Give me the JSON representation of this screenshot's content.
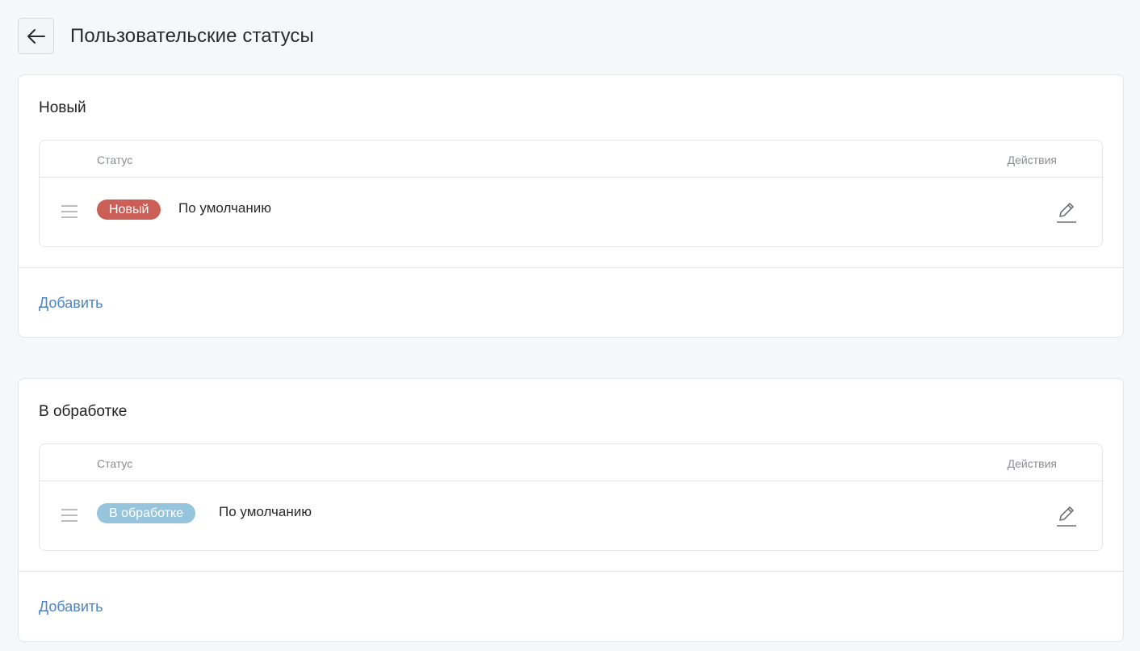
{
  "page": {
    "title": "Пользовательские статусы",
    "back_icon": "arrow-left-icon"
  },
  "table_headers": {
    "status": "Статус",
    "actions": "Действия"
  },
  "groups": [
    {
      "title": "Новый",
      "rows": [
        {
          "badge": "Новый",
          "badge_color": "#cb5f57",
          "default_label": "По умолчанию",
          "drag_icon": "drag-handle-icon",
          "edit_icon": "pencil-edit-icon"
        }
      ],
      "add_label": "Добавить"
    },
    {
      "title": "В обработке",
      "rows": [
        {
          "badge": "В обработке",
          "badge_color": "#96c4dc",
          "default_label": "По умолчанию",
          "drag_icon": "drag-handle-icon",
          "edit_icon": "pencil-edit-icon"
        }
      ],
      "add_label": "Добавить"
    }
  ],
  "colors": {
    "link": "#4f84c4",
    "background": "#f6f7f9",
    "border": "#e3e5e8"
  }
}
